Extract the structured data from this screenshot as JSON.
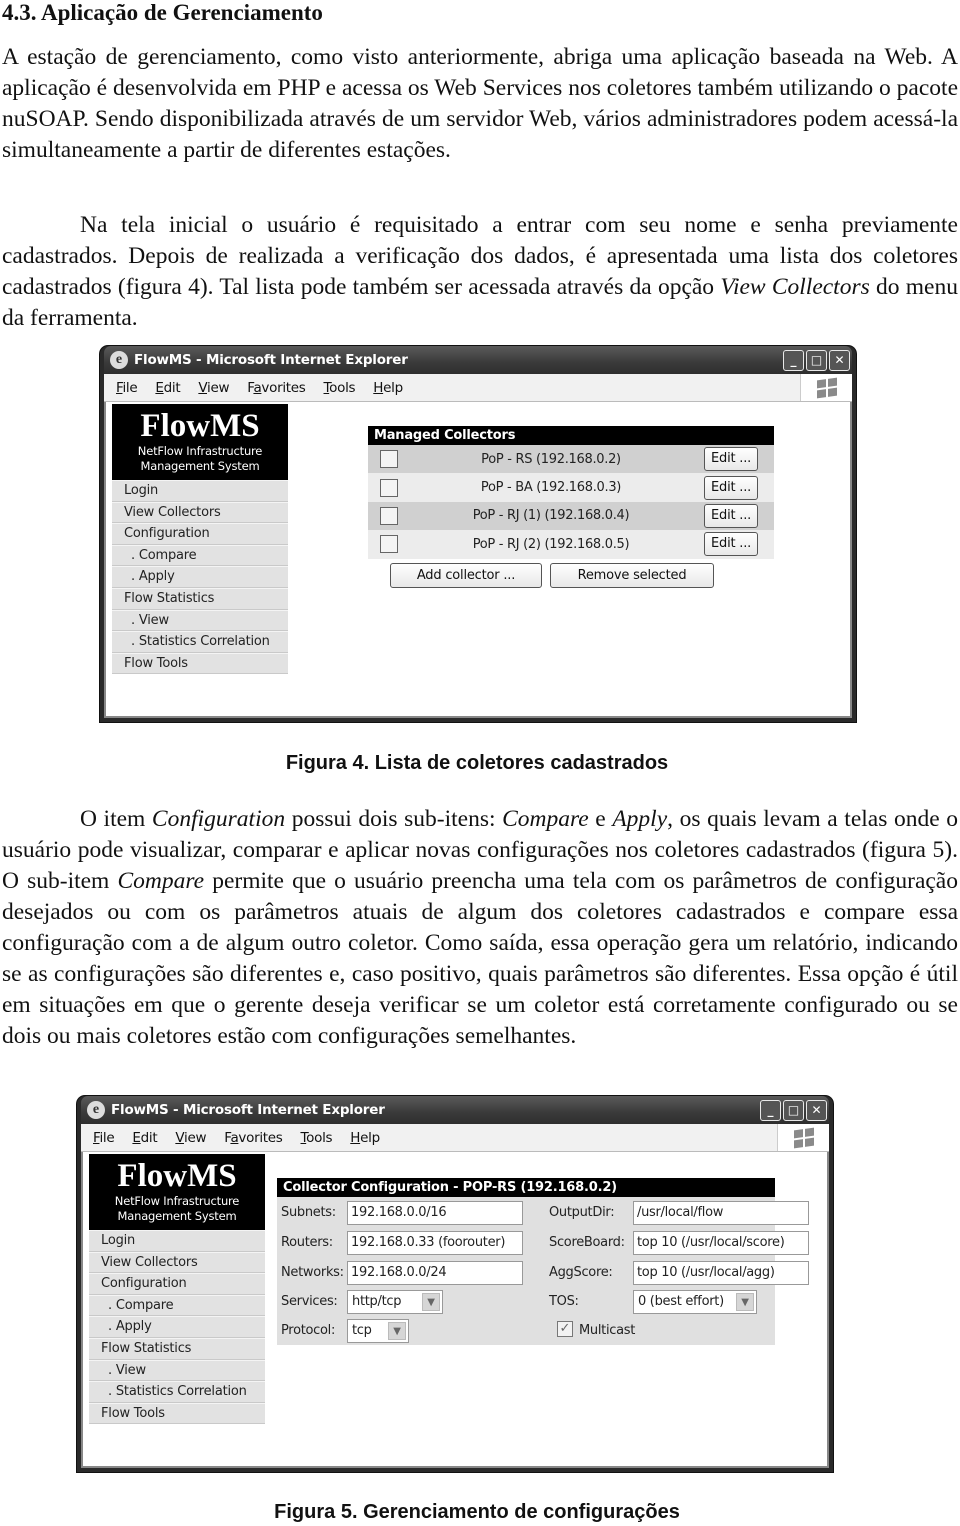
{
  "section_heading": "4.3. Aplicação de Gerenciamento",
  "paragraph1": "A estação de gerenciamento, como visto anteriormente, abriga uma aplicação baseada na Web. A aplicação é desenvolvida em PHP e acessa os Web Services nos coletores também utilizando o pacote nuSOAP. Sendo disponibilizada através de um servidor Web, vários administradores podem acessá-la simultaneamente a partir de diferentes estações.",
  "paragraph2": {
    "before": "Na tela inicial o usuário é requisitado a entrar com seu nome e senha previamente cadastrados. Depois de realizada a verificação dos dados, é apresentada uma lista dos coletores cadastrados (figura 4). Tal lista pode também ser acessada através da opção ",
    "italic": "View Collectors",
    "after": " do menu da ferramenta."
  },
  "paragraph3": {
    "t1": "O item ",
    "i1": "Configuration",
    "t2": " possui dois sub-itens: ",
    "i2": "Compare",
    "t3": " e ",
    "i3": "Apply",
    "t4": ", os quais levam a telas onde o usuário pode visualizar, comparar e aplicar novas configurações nos coletores cadastrados (figura 5). O sub-item ",
    "i4": "Compare",
    "t5": " permite que o usuário preencha uma tela com os parâmetros de configuração desejados ou com os parâmetros atuais de algum dos coletores cadastrados e compare essa configuração com a de algum outro coletor. Como saída, essa operação gera um relatório, indicando se as configurações são diferentes e, caso positivo, quais parâmetros são diferentes. Essa opção é útil em situações em que o gerente deseja verificar se um coletor está corretamente configurado ou se dois ou mais coletores estão com configurações semelhantes."
  },
  "figure4": {
    "caption": "Figura 4. Lista de coletores cadastrados",
    "window_title": "FlowMS - Microsoft Internet Explorer",
    "panel_title": "Managed Collectors",
    "collectors": [
      {
        "name": "PoP - RS (192.168.0.2)",
        "checked": false
      },
      {
        "name": "PoP - BA (192.168.0.3)",
        "checked": false
      },
      {
        "name": "PoP - RJ (1) (192.168.0.4)",
        "checked": false
      },
      {
        "name": "PoP - RJ (2) (192.168.0.5)",
        "checked": false
      }
    ],
    "edit_label": "Edit ...",
    "add_label": "Add collector ...",
    "remove_label": "Remove selected"
  },
  "figure5": {
    "caption": "Figura 5. Gerenciamento de configurações",
    "window_title": "FlowMS - Microsoft Internet Explorer",
    "panel_title": "Collector Configuration - POP-RS (192.168.0.2)",
    "fields": {
      "subnets": {
        "label": "Subnets:",
        "value": "192.168.0.0/16"
      },
      "routers": {
        "label": "Routers:",
        "value": "192.168.0.33 (foorouter)"
      },
      "networks": {
        "label": "Networks:",
        "value": "192.168.0.0/24"
      },
      "services": {
        "label": "Services:",
        "value": "http/tcp"
      },
      "protocol": {
        "label": "Protocol:",
        "value": "tcp"
      },
      "outputdir": {
        "label": "OutputDir:",
        "value": "/usr/local/flow"
      },
      "scoreboard": {
        "label": "ScoreBoard:",
        "value": "top 10 (/usr/local/score)"
      },
      "aggscore": {
        "label": "AggScore:",
        "value": "top 10 (/usr/local/agg)"
      },
      "tos": {
        "label": "TOS:",
        "value": "0 (best effort)"
      },
      "multicast": {
        "label": "Multicast",
        "checked": true
      }
    }
  },
  "browser": {
    "menu": [
      {
        "u": "F",
        "rest": "ile"
      },
      {
        "u": "E",
        "rest": "dit"
      },
      {
        "u": "V",
        "rest": "iew"
      },
      {
        "pre": "F",
        "u": "a",
        "rest": "vorites"
      },
      {
        "u": "T",
        "rest": "ools"
      },
      {
        "u": "H",
        "rest": "elp"
      }
    ],
    "window_buttons": {
      "minimize": "_",
      "maximize": "□",
      "close": "✕"
    }
  },
  "flowms": {
    "logo_title": "FlowMS",
    "logo_sub1": "NetFlow Infrastructure",
    "logo_sub2": "Management System",
    "nav": [
      {
        "label": "Login",
        "sub": false
      },
      {
        "label": "View Collectors",
        "sub": false
      },
      {
        "label": "Configuration",
        "sub": false
      },
      {
        "label": ". Compare",
        "sub": true
      },
      {
        "label": ". Apply",
        "sub": true
      },
      {
        "label": "Flow Statistics",
        "sub": false
      },
      {
        "label": ". View",
        "sub": true
      },
      {
        "label": ". Statistics Correlation",
        "sub": true
      },
      {
        "label": "Flow Tools",
        "sub": false
      }
    ]
  },
  "icons": {
    "ie": "e",
    "check": "✓",
    "dropdown": "▼"
  }
}
